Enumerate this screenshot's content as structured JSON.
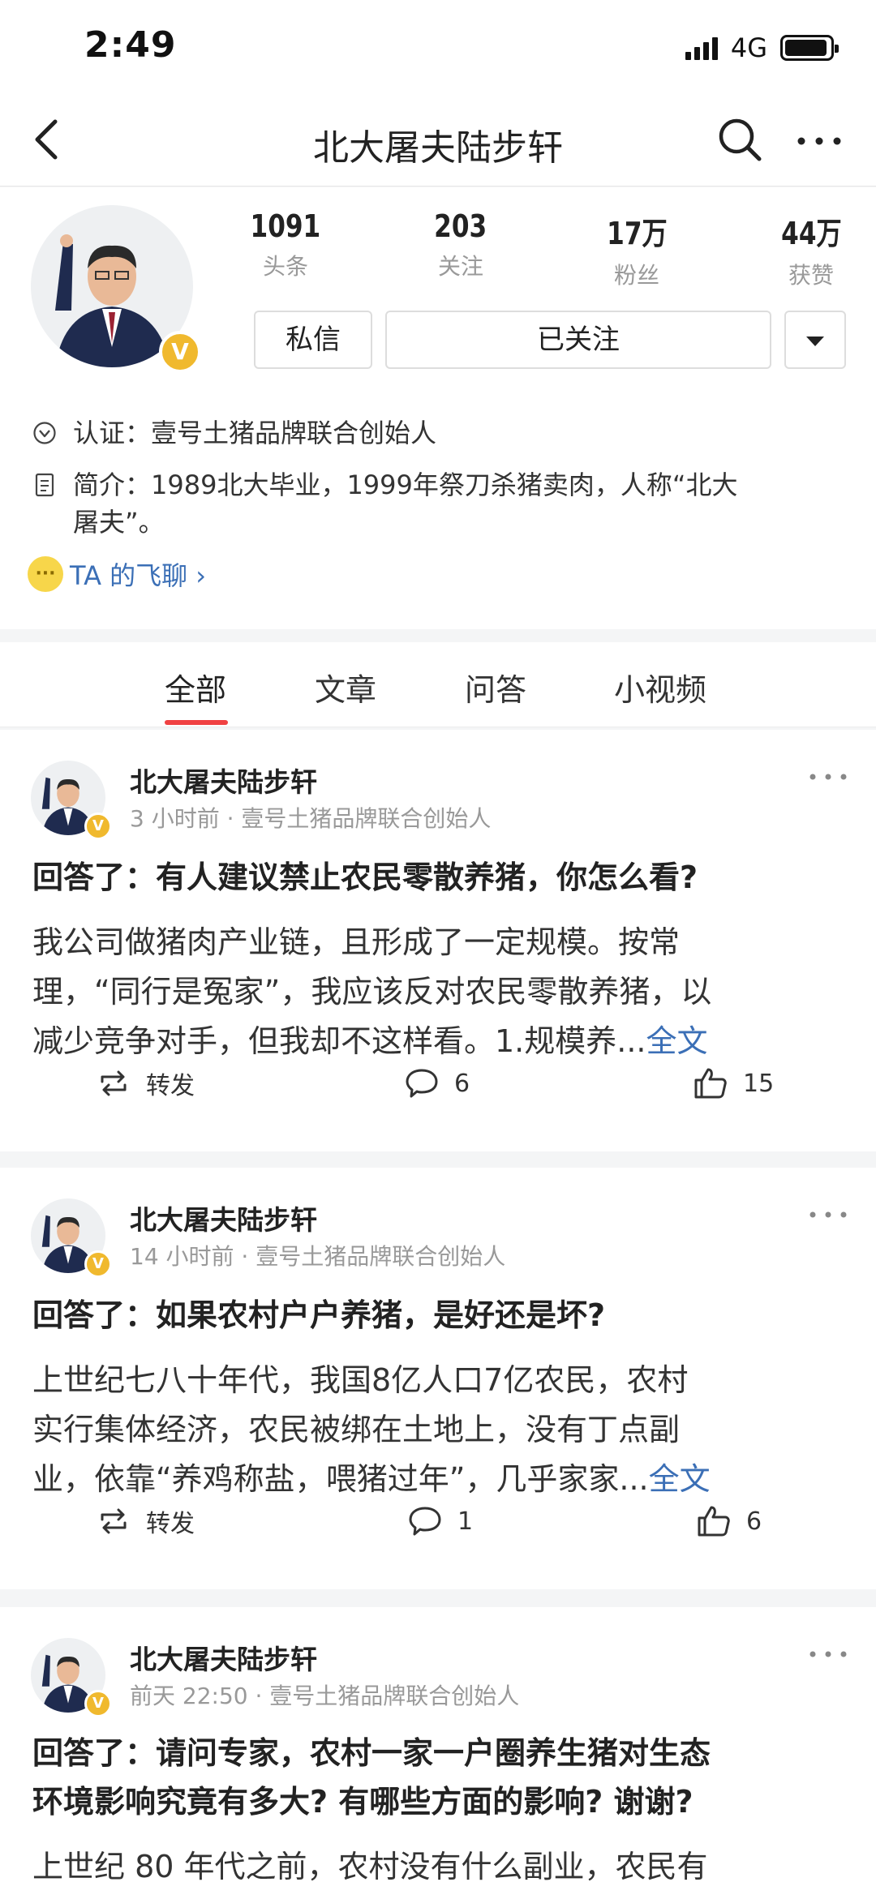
{
  "status_bar": {
    "time": "2:49",
    "network": "4G",
    "battery_level": 0.95
  },
  "nav": {
    "title": "北大屠夫陆步轩"
  },
  "profile": {
    "verified_badge": "V",
    "stats": [
      {
        "value": "1091",
        "label": "头条"
      },
      {
        "value": "203",
        "label": "关注"
      },
      {
        "value": "17万",
        "label": "粉丝"
      },
      {
        "value": "44万",
        "label": "获赞"
      }
    ],
    "buttons": {
      "message": "私信",
      "followed": "已关注"
    },
    "certification": "认证：壹号土猪品牌联合创始人",
    "intro_line1": "简介：1989北大毕业，1999年祭刀杀猪卖肉，人称“北大",
    "intro_line2": "屠夫”。",
    "feiliao": "TA 的飞聊 ›"
  },
  "tabs": [
    "全部",
    "文章",
    "问答",
    "小视频"
  ],
  "posts": [
    {
      "author": "北大屠夫陆步轩",
      "meta": "3 小时前 · 壹号土猪品牌联合创始人",
      "title": "回答了：有人建议禁止农民零散养猪，你怎么看?",
      "body_lines": [
        "我公司做猪肉产业链，且形成了一定规模。按常",
        "理，“同行是冤家”，我应该反对农民零散养猪，以",
        "减少竞争对手，但我却不这样看。1.规模养..."
      ],
      "read_more": "全文",
      "repost": "转发",
      "comments": "6",
      "likes": "15"
    },
    {
      "author": "北大屠夫陆步轩",
      "meta": "14 小时前 · 壹号土猪品牌联合创始人",
      "title": "回答了：如果农村户户养猪，是好还是坏?",
      "body_lines": [
        "上世纪七八十年代，我国8亿人口7亿农民，农村",
        "实行集体经济，农民被绑在土地上，没有丁点副",
        "业，依靠“养鸡称盐，喂猪过年”，几乎家家..."
      ],
      "read_more": "全文",
      "repost": "转发",
      "comments": "1",
      "likes": "6"
    },
    {
      "author": "北大屠夫陆步轩",
      "meta": "前天 22:50 · 壹号土猪品牌联合创始人",
      "title_lines": [
        "回答了：请问专家，农村一家一户圈养生猪对生态",
        "环境影响究竟有多大? 有哪些方面的影响? 谢谢?"
      ],
      "body_lines": [
        "上世纪 80 年代之前，农村没有什么副业，农民有"
      ]
    }
  ]
}
